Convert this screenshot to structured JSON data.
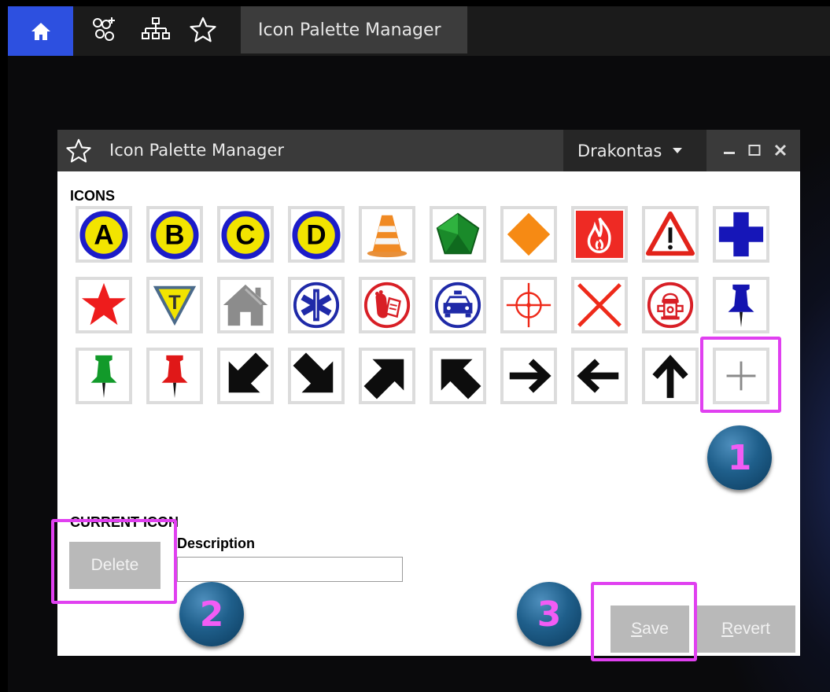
{
  "topbar": {
    "icons": [
      "home-icon",
      "user-group-add-icon",
      "org-chart-icon",
      "star-icon"
    ],
    "active_tab": "Icon Palette Manager",
    "colors": {
      "home_bg": "#2d50e0",
      "bar_bg": "#1b1b1b",
      "tab_bg": "#3c3c3c"
    }
  },
  "dialog": {
    "title": "Icon Palette Manager",
    "title_icon": "star-icon",
    "user_dropdown": "Drakontas",
    "window_controls": [
      "minimize-icon",
      "maximize-icon",
      "close-icon"
    ],
    "icons_label": "ICONS",
    "icons": [
      {
        "name": "letter-a-marker",
        "label": "A"
      },
      {
        "name": "letter-b-marker",
        "label": "B"
      },
      {
        "name": "letter-c-marker",
        "label": "C"
      },
      {
        "name": "letter-d-marker",
        "label": "D"
      },
      {
        "name": "traffic-cone"
      },
      {
        "name": "green-pentagon"
      },
      {
        "name": "orange-diamond"
      },
      {
        "name": "fire-hazard"
      },
      {
        "name": "warning-triangle"
      },
      {
        "name": "blue-cross"
      },
      {
        "name": "red-star"
      },
      {
        "name": "letter-t-triangle",
        "label": "T"
      },
      {
        "name": "house"
      },
      {
        "name": "star-of-life"
      },
      {
        "name": "toe-tag-morgue"
      },
      {
        "name": "police-car"
      },
      {
        "name": "crosshair"
      },
      {
        "name": "red-x"
      },
      {
        "name": "fire-hydrant"
      },
      {
        "name": "blue-pushpin"
      },
      {
        "name": "green-pushpin"
      },
      {
        "name": "red-pushpin"
      },
      {
        "name": "arrow-down-left"
      },
      {
        "name": "arrow-down-right"
      },
      {
        "name": "arrow-up-right"
      },
      {
        "name": "arrow-up-left"
      },
      {
        "name": "arrow-right"
      },
      {
        "name": "arrow-left"
      },
      {
        "name": "arrow-up"
      },
      {
        "name": "add-icon"
      }
    ],
    "current_icon_label": "CURRENT ICON",
    "description_label": "Description",
    "description_value": "",
    "delete_label": "Delete",
    "save_label": "Save",
    "revert_label": "Revert"
  },
  "callouts": {
    "one": "1",
    "two": "2",
    "three": "3",
    "color": "#e040f0"
  }
}
